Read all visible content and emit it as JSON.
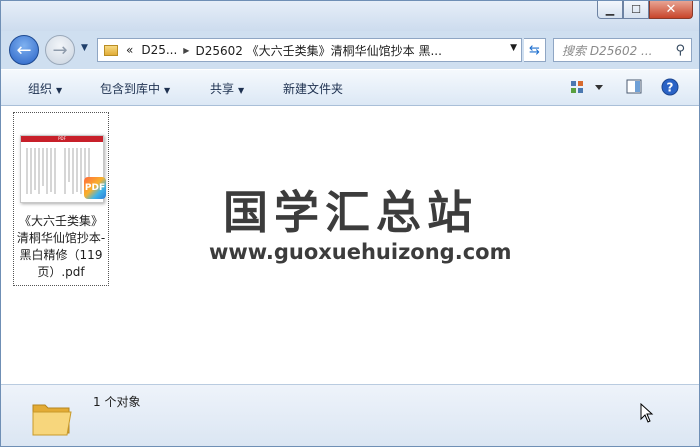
{
  "window": {
    "address": {
      "overflow": "«",
      "crumb1": "D25...",
      "crumb2": "D25602 《大六壬类集》清桐华仙馆抄本 黑..."
    },
    "search_placeholder": "搜索 D25602 ..."
  },
  "toolbar": {
    "organize": "组织",
    "include_in_library": "包含到库中",
    "share": "共享",
    "new_folder": "新建文件夹"
  },
  "files": [
    {
      "name": "《大六壬类集》清桐华仙馆抄本-黑白精修（119页）.pdf",
      "type": "pdf",
      "badge": "PDF",
      "header": "PDF"
    }
  ],
  "watermark": {
    "title": "国学汇总站",
    "url": "www.guoxuehuizong.com"
  },
  "details": {
    "count_text": "1 个对象"
  },
  "colors": {
    "accent": "#2a63c6",
    "pdf_red": "#c8202a"
  }
}
